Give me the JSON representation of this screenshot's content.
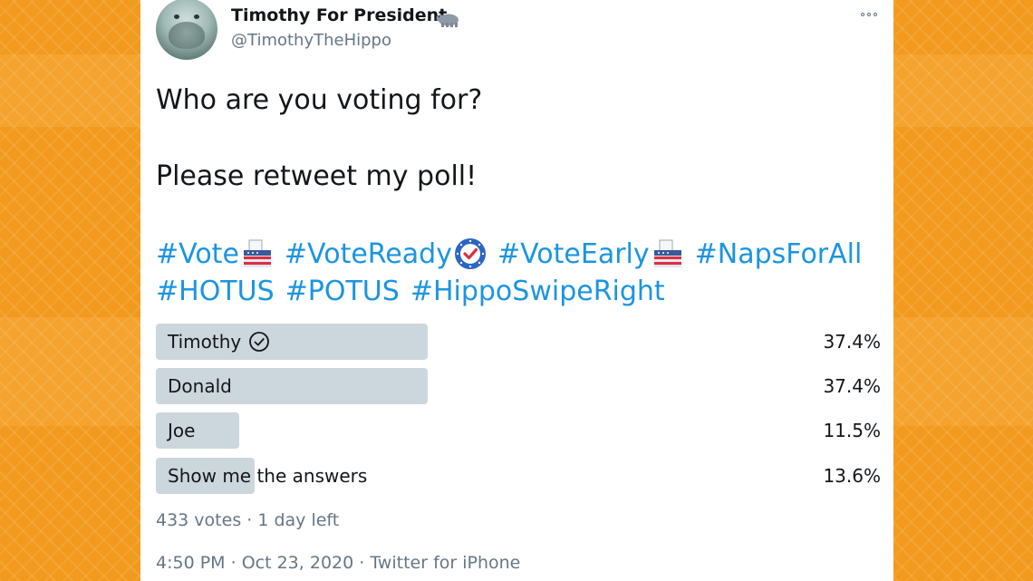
{
  "colors": {
    "background": "#f29a1e",
    "link": "#1b95e0",
    "poll_bar": "#ccd6dd",
    "text": "#14171a",
    "muted": "#657786"
  },
  "author": {
    "display_name": "Timothy For President",
    "name_emoji": "hippo-icon",
    "handle": "@TimothyTheHippo"
  },
  "tweet": {
    "line1": "Who are you voting for?",
    "line2": "Please retweet my poll!",
    "hashtags_row1": [
      {
        "text": "#Vote",
        "emoji": "ballot-box-icon"
      },
      {
        "text": "#VoteReady",
        "emoji": "vote-ready-badge-icon"
      },
      {
        "text": "#VoteEarly",
        "emoji": "ballot-box-icon"
      },
      {
        "text": "#NapsForAll",
        "emoji": ""
      }
    ],
    "hashtags_row2": [
      {
        "text": "#HOTUS"
      },
      {
        "text": "#POTUS"
      },
      {
        "text": "#HippoSwipeRight"
      }
    ]
  },
  "poll": {
    "options": [
      {
        "label": "Timothy",
        "percent_text": "37.4%",
        "percent": 37.4,
        "selected": true
      },
      {
        "label": "Donald",
        "percent_text": "37.4%",
        "percent": 37.4,
        "selected": false
      },
      {
        "label": "Joe",
        "percent_text": "11.5%",
        "percent": 11.5,
        "selected": false
      },
      {
        "label": "Show me the answers",
        "percent_text": "13.6%",
        "percent": 13.6,
        "selected": false
      }
    ],
    "meta": "433 votes · 1 day left"
  },
  "footer": {
    "time": "4:50 PM",
    "date": "Oct 23, 2020",
    "source": "Twitter for iPhone"
  }
}
